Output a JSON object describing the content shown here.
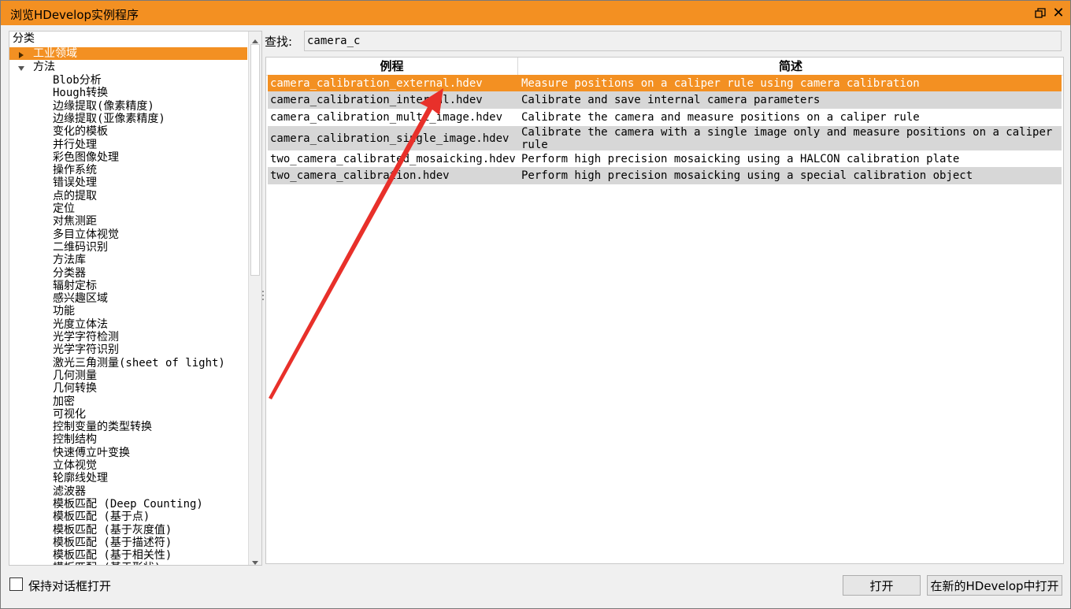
{
  "window": {
    "title": "浏览HDevelop实例程序",
    "accent_color": "#f39022"
  },
  "tree": {
    "header": "分类",
    "industry_label": "工业领域",
    "method_label": "方法",
    "methods": [
      "Blob分析",
      "Hough转换",
      "边缘提取(像素精度)",
      "边缘提取(亚像素精度)",
      "变化的模板",
      "并行处理",
      "彩色图像处理",
      "操作系统",
      "错误处理",
      "点的提取",
      "定位",
      "对焦测距",
      "多目立体视觉",
      "二维码识别",
      "方法库",
      "分类器",
      "辐射定标",
      "感兴趣区域",
      "功能",
      "光度立体法",
      "光学字符检测",
      "光学字符识别",
      "激光三角测量(sheet of light)",
      "几何测量",
      "几何转换",
      "加密",
      "可视化",
      "控制变量的类型转换",
      "控制结构",
      "快速傅立叶变换",
      "立体视觉",
      "轮廓线处理",
      "滤波器",
      "模板匹配 (Deep Counting)",
      "模板匹配 (基于点)",
      "模板匹配 (基于灰度值)",
      "模板匹配 (基于描述符)",
      "模板匹配 (基于相关性)",
      "模板匹配 (基于形状)"
    ]
  },
  "search": {
    "label": "查找:",
    "value": "camera_c"
  },
  "table": {
    "col_program": "例程",
    "col_description": "简述",
    "rows": [
      {
        "program": "camera_calibration_external.hdev",
        "description": "Measure positions on a caliper rule using camera calibration"
      },
      {
        "program": "camera_calibration_internal.hdev",
        "description": "Calibrate and save internal camera parameters"
      },
      {
        "program": "camera_calibration_multi_image.hdev",
        "description": "Calibrate the camera and measure positions on a caliper rule"
      },
      {
        "program": "camera_calibration_single_image.hdev",
        "description": "Calibrate the camera with a single image only and measure positions on a caliper rule"
      },
      {
        "program": "two_camera_calibrated_mosaicking.hdev",
        "description": "Perform high precision mosaicking using a HALCON calibration plate"
      },
      {
        "program": "two_camera_calibration.hdev",
        "description": "Perform high precision mosaicking using a special calibration object"
      }
    ]
  },
  "footer": {
    "keep_dialog_label": "保持对话框打开",
    "open_label": "打开",
    "open_new_label": "在新的HDevelop中打开"
  },
  "annotation": {
    "arrow_color": "#e8302a"
  }
}
